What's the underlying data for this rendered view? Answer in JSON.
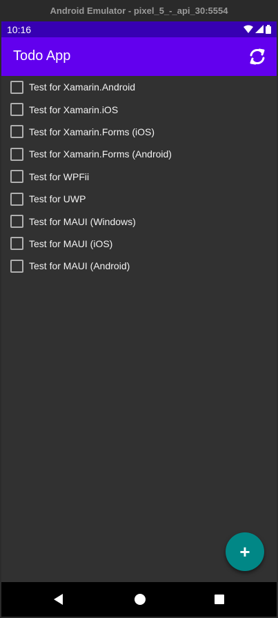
{
  "window": {
    "title": "Android Emulator - pixel_5_-_api_30:5554"
  },
  "status_bar": {
    "time": "10:16",
    "icons": [
      "wifi-icon",
      "signal-icon",
      "battery-icon"
    ]
  },
  "app_bar": {
    "title": "Todo App",
    "refresh_icon": "refresh-icon"
  },
  "todos": [
    {
      "label": "Test for Xamarin.Android",
      "checked": false
    },
    {
      "label": "Test for Xamarin.iOS",
      "checked": false
    },
    {
      "label": "Test for Xamarin.Forms (iOS)",
      "checked": false
    },
    {
      "label": "Test for Xamarin.Forms (Android)",
      "checked": false
    },
    {
      "label": "Test for WPFii",
      "checked": false
    },
    {
      "label": "Test for UWP",
      "checked": false
    },
    {
      "label": "Test for MAUI (Windows)",
      "checked": false
    },
    {
      "label": "Test for MAUI (iOS)",
      "checked": false
    },
    {
      "label": "Test for MAUI (Android)",
      "checked": false
    }
  ],
  "fab": {
    "label": "+"
  },
  "nav_bar": {
    "icons": [
      "back-icon",
      "home-icon",
      "recent-apps-icon"
    ]
  },
  "colors": {
    "status_bar": "#3700b3",
    "app_bar": "#6200ee",
    "background": "#313131",
    "fab": "#018786"
  }
}
